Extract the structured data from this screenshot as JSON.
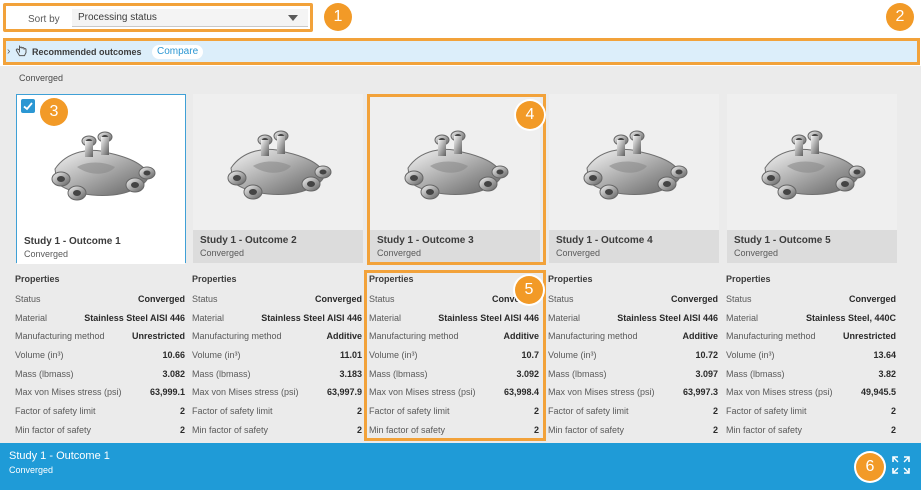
{
  "sort": {
    "label": "Sort by",
    "value": "Processing status"
  },
  "recommended": {
    "label": "Recommended outcomes",
    "compare_label": "Compare"
  },
  "group_title": "Converged",
  "callouts": [
    "1",
    "2",
    "3",
    "4",
    "5",
    "6"
  ],
  "cards": [
    {
      "title": "Study 1 - Outcome 1",
      "status": "Converged",
      "selected": true
    },
    {
      "title": "Study 1 - Outcome 2",
      "status": "Converged",
      "selected": false
    },
    {
      "title": "Study 1 - Outcome 3",
      "status": "Converged",
      "selected": false
    },
    {
      "title": "Study 1 - Outcome 4",
      "status": "Converged",
      "selected": false
    },
    {
      "title": "Study 1 - Outcome 5",
      "status": "Converged",
      "selected": false
    }
  ],
  "properties_header": "Properties",
  "property_labels": [
    "Status",
    "Material",
    "Manufacturing method",
    "Volume (in³)",
    "Mass (lbmass)",
    "Max von Mises stress (psi)",
    "Factor of safety limit",
    "Min factor of safety"
  ],
  "property_values": [
    [
      "Converged",
      "Stainless Steel AISI 446",
      "Unrestricted",
      "10.66",
      "3.082",
      "63,999.1",
      "2",
      "2"
    ],
    [
      "Converged",
      "Stainless Steel AISI 446",
      "Additive",
      "11.01",
      "3.183",
      "63,997.9",
      "2",
      "2"
    ],
    [
      "Converged",
      "Stainless Steel AISI 446",
      "Additive",
      "10.7",
      "3.092",
      "63,998.4",
      "2",
      "2"
    ],
    [
      "Converged",
      "Stainless Steel AISI 446",
      "Additive",
      "10.72",
      "3.097",
      "63,997.3",
      "2",
      "2"
    ],
    [
      "Converged",
      "Stainless Steel, 440C",
      "Unrestricted",
      "13.64",
      "3.82",
      "49,945.5",
      "2",
      "2"
    ]
  ],
  "footer": {
    "title": "Study 1 - Outcome 1",
    "status": "Converged"
  },
  "colors": {
    "accent": "#1f9bd7",
    "callout": "#f29a27",
    "highlight": "#f2a23a"
  },
  "icons": {
    "sort_caret": "chevron-down-icon",
    "rec_chevron": "chevron-right-icon",
    "rec_icon": "hand-pointer-icon",
    "checkbox": "checkmark-icon",
    "thumbnail": "bracket-part-icon",
    "expand": "expand-icon"
  }
}
